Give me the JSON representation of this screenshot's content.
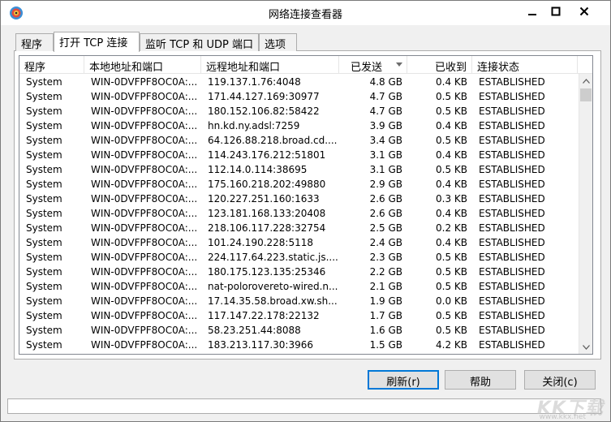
{
  "window": {
    "title": "网络连接查看器"
  },
  "tabs": [
    {
      "label": "程序"
    },
    {
      "label": "打开 TCP 连接"
    },
    {
      "label": "监听 TCP 和 UDP 端口"
    },
    {
      "label": "选项"
    }
  ],
  "table": {
    "columns": [
      "程序",
      "本地地址和端口",
      "远程地址和端口",
      "已发送",
      "已收到",
      "连接状态"
    ],
    "sort_column": "已发送",
    "rows": [
      [
        "System",
        "WIN-0DVFPF8OC0A:...",
        "119.137.1.76:4048",
        "4.8 GB",
        "0.4 KB",
        "ESTABLISHED"
      ],
      [
        "System",
        "WIN-0DVFPF8OC0A:...",
        "171.44.127.169:30977",
        "4.7 GB",
        "0.5 KB",
        "ESTABLISHED"
      ],
      [
        "System",
        "WIN-0DVFPF8OC0A:...",
        "180.152.106.82:58422",
        "4.7 GB",
        "0.5 KB",
        "ESTABLISHED"
      ],
      [
        "System",
        "WIN-0DVFPF8OC0A:...",
        "hn.kd.ny.adsl:7259",
        "3.9 GB",
        "0.4 KB",
        "ESTABLISHED"
      ],
      [
        "System",
        "WIN-0DVFPF8OC0A:...",
        "64.126.88.218.broad.cd....",
        "3.4 GB",
        "0.5 KB",
        "ESTABLISHED"
      ],
      [
        "System",
        "WIN-0DVFPF8OC0A:...",
        "114.243.176.212:51801",
        "3.1 GB",
        "0.4 KB",
        "ESTABLISHED"
      ],
      [
        "System",
        "WIN-0DVFPF8OC0A:...",
        "112.14.0.114:38695",
        "3.1 GB",
        "0.5 KB",
        "ESTABLISHED"
      ],
      [
        "System",
        "WIN-0DVFPF8OC0A:...",
        "175.160.218.202:49880",
        "2.9 GB",
        "0.4 KB",
        "ESTABLISHED"
      ],
      [
        "System",
        "WIN-0DVFPF8OC0A:...",
        "120.227.251.160:1633",
        "2.6 GB",
        "0.3 KB",
        "ESTABLISHED"
      ],
      [
        "System",
        "WIN-0DVFPF8OC0A:...",
        "123.181.168.133:20408",
        "2.6 GB",
        "0.4 KB",
        "ESTABLISHED"
      ],
      [
        "System",
        "WIN-0DVFPF8OC0A:...",
        "218.106.117.228:32754",
        "2.5 GB",
        "0.2 KB",
        "ESTABLISHED"
      ],
      [
        "System",
        "WIN-0DVFPF8OC0A:...",
        "101.24.190.228:5118",
        "2.4 GB",
        "0.4 KB",
        "ESTABLISHED"
      ],
      [
        "System",
        "WIN-0DVFPF8OC0A:...",
        "224.117.64.223.static.js....",
        "2.3 GB",
        "0.5 KB",
        "ESTABLISHED"
      ],
      [
        "System",
        "WIN-0DVFPF8OC0A:...",
        "180.175.123.135:25346",
        "2.2 GB",
        "0.5 KB",
        "ESTABLISHED"
      ],
      [
        "System",
        "WIN-0DVFPF8OC0A:...",
        "nat-polorovereto-wired.n...",
        "2.1 GB",
        "0.5 KB",
        "ESTABLISHED"
      ],
      [
        "System",
        "WIN-0DVFPF8OC0A:...",
        "17.14.35.58.broad.xw.sh...",
        "1.9 GB",
        "0.0 KB",
        "ESTABLISHED"
      ],
      [
        "System",
        "WIN-0DVFPF8OC0A:...",
        "117.147.22.178:22132",
        "1.7 GB",
        "0.5 KB",
        "ESTABLISHED"
      ],
      [
        "System",
        "WIN-0DVFPF8OC0A:...",
        "58.23.251.44:8088",
        "1.6 GB",
        "0.5 KB",
        "ESTABLISHED"
      ],
      [
        "System",
        "WIN-0DVFPF8OC0A:...",
        "183.213.117.30:3966",
        "1.5 GB",
        "4.2 KB",
        "ESTABLISHED"
      ]
    ]
  },
  "buttons": {
    "refresh": "刷新(r)",
    "help": "帮助",
    "close": "关闭(c)"
  },
  "watermark": {
    "main": "KK下载",
    "sub": "www.kkx.net"
  },
  "colors": {
    "accent": "#0078d7",
    "panel_bg": "#f0f0f0"
  }
}
